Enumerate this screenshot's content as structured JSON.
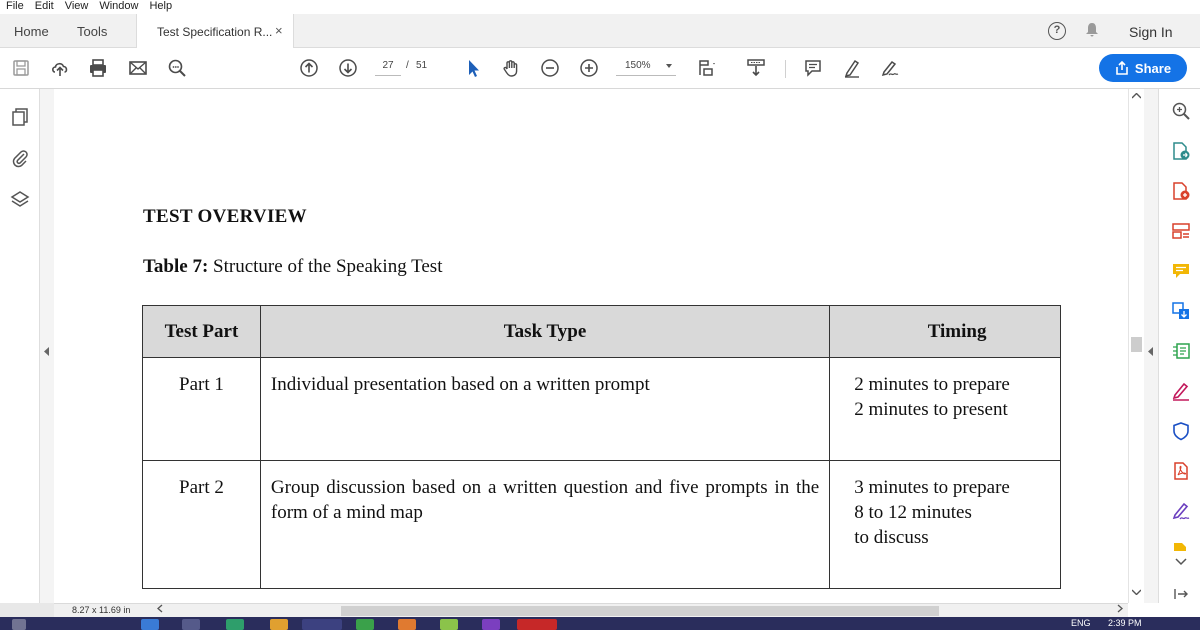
{
  "menu": [
    "File",
    "Edit",
    "View",
    "Window",
    "Help"
  ],
  "tabs": {
    "home": "Home",
    "tools": "Tools",
    "document": "Test Specification R...",
    "close_glyph": "×"
  },
  "header_right": {
    "help_glyph": "?",
    "sign_in": "Sign In"
  },
  "toolbar": {
    "current_page": "27",
    "page_separator": "/",
    "total_pages": "51",
    "zoom": "150%",
    "share_label": "Share"
  },
  "document": {
    "heading": "TEST OVERVIEW",
    "caption_label": "Table 7:",
    "caption_text": " Structure of the Speaking Test",
    "table": {
      "headers": [
        "Test Part",
        "Task Type",
        "Timing"
      ],
      "rows": [
        {
          "part": "Part 1",
          "task": "Individual presentation based on a written prompt",
          "timing": [
            "2 minutes to prepare",
            "2 minutes to present"
          ]
        },
        {
          "part": "Part 2",
          "task": "Group discussion based on a written question and five prompts in the form of a mind map",
          "timing": [
            "3 minutes to prepare",
            "8 to 12 minutes",
            "to discuss"
          ]
        }
      ]
    }
  },
  "status": {
    "page_size": "8.27 x 11.69 in"
  },
  "taskbar": {
    "language": "ENG",
    "time": "2:39 PM"
  },
  "colors": {
    "accent": "#1473e6",
    "table_header_bg": "#d9d9d9",
    "taskbar": "#2a2d5c"
  },
  "icons": {
    "toolbar": [
      "save-icon",
      "upload-cloud-icon",
      "print-icon",
      "email-icon",
      "search-zoom-icon",
      "page-up-icon",
      "page-down-icon",
      "select-arrow-icon",
      "hand-icon",
      "zoom-out-icon",
      "zoom-in-icon",
      "page-fit-icon",
      "scroll-mode-icon",
      "comment-icon",
      "highlight-icon",
      "sign-icon"
    ],
    "left_rail": [
      "pages-icon",
      "attachment-icon",
      "layers-icon"
    ],
    "right_rail": [
      "zoom-search-icon",
      "export-pdf-icon",
      "create-pdf-icon",
      "organize-pages-icon",
      "comment-tool-icon",
      "combine-files-icon",
      "edit-pdf-icon",
      "fill-sign-icon",
      "protect-icon",
      "acrobat-pdf-icon",
      "send-sign-icon",
      "more-tools-icon"
    ]
  }
}
